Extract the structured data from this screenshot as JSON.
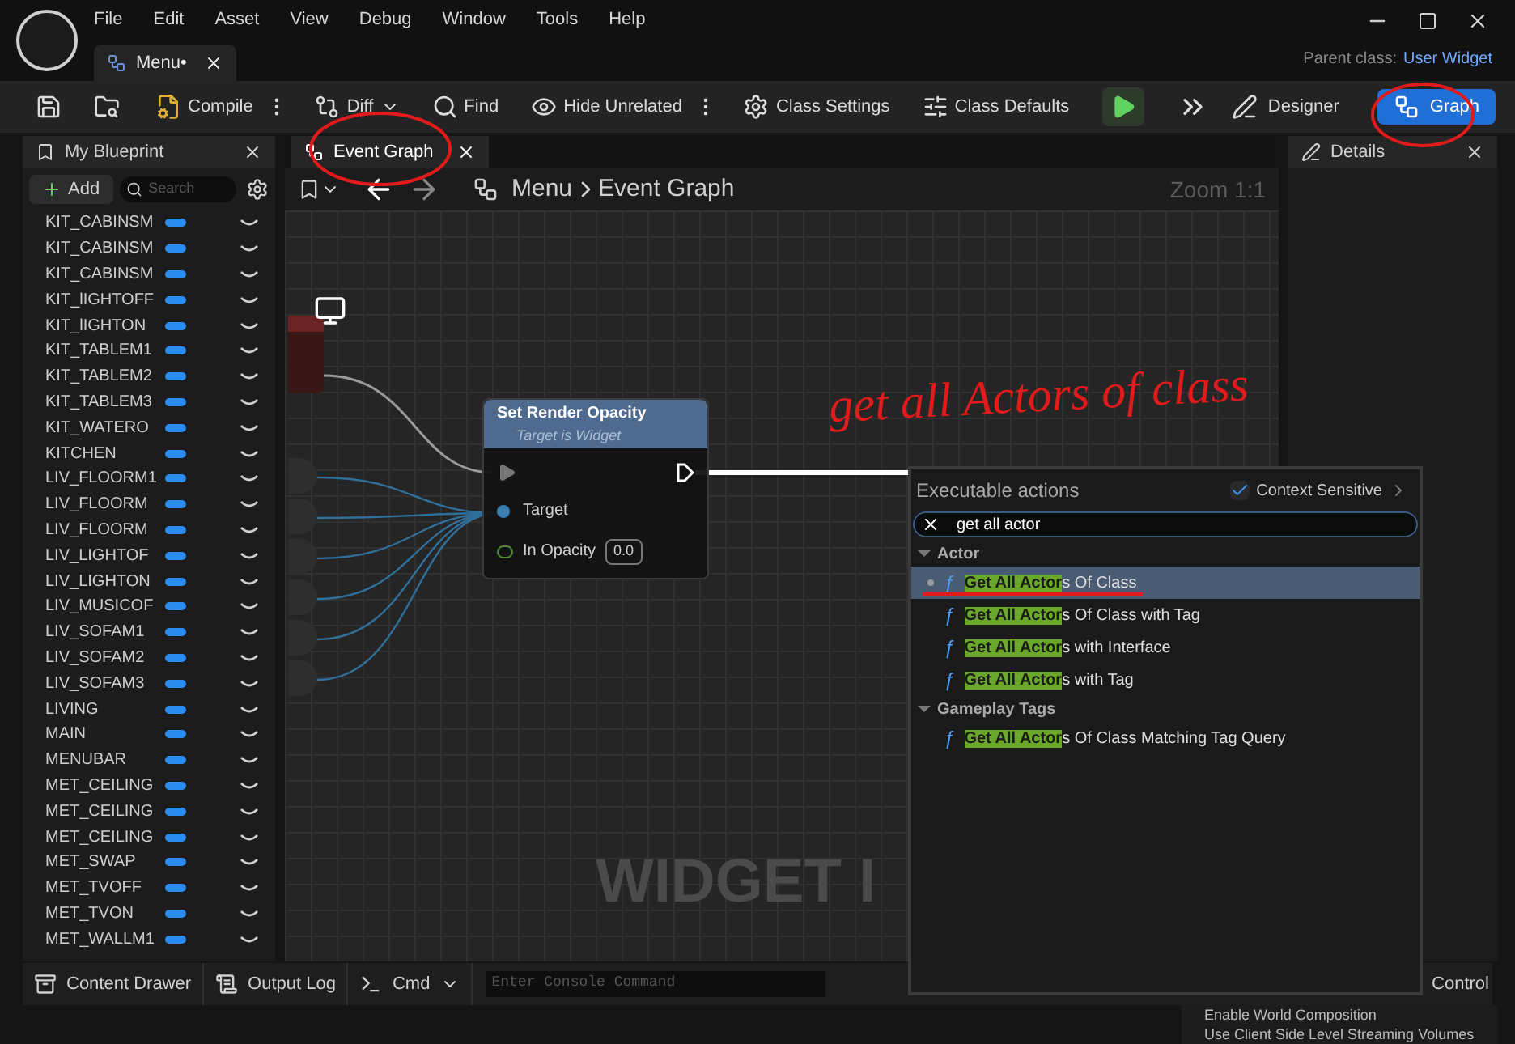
{
  "menu_bar": [
    "File",
    "Edit",
    "Asset",
    "View",
    "Debug",
    "Window",
    "Tools",
    "Help"
  ],
  "document_tab": {
    "label": "Menu•"
  },
  "parent_class": {
    "label": "Parent class:",
    "value": "User Widget"
  },
  "toolbar": [
    {
      "label": "Compile",
      "kind": "compile"
    },
    {
      "label": "Diff",
      "kind": "diff"
    },
    {
      "label": "Find",
      "kind": "find"
    },
    {
      "label": "Hide Unrelated",
      "kind": "hide"
    },
    {
      "label": "Class Settings",
      "kind": "settings"
    },
    {
      "label": "Class Defaults",
      "kind": "defaults"
    }
  ],
  "modes": [
    {
      "label": "Designer",
      "selected": false
    },
    {
      "label": "Graph",
      "selected": true
    }
  ],
  "my_blueprint": {
    "title": "My Blueprint",
    "add_label": "Add",
    "search_placeholder": "Search",
    "variables": [
      {
        "name": "KIT_CABINSM"
      },
      {
        "name": "KIT_CABINSM"
      },
      {
        "name": "KIT_CABINSM"
      },
      {
        "name": "KIT_lIGHTOFF"
      },
      {
        "name": "KIT_lIGHTON"
      },
      {
        "name": "KIT_TABLEM1"
      },
      {
        "name": "KIT_TABLEM2"
      },
      {
        "name": "KIT_TABLEM3"
      },
      {
        "name": "KIT_WATERO"
      },
      {
        "name": "KITCHEN"
      },
      {
        "name": "LIV_FLOORM1"
      },
      {
        "name": "LIV_FLOORM"
      },
      {
        "name": "LIV_FLOORM"
      },
      {
        "name": "LIV_LIGHTOF"
      },
      {
        "name": "LIV_LIGHTON"
      },
      {
        "name": "LIV_MUSICOF"
      },
      {
        "name": "LIV_SOFAM1"
      },
      {
        "name": "LIV_SOFAM2"
      },
      {
        "name": "LIV_SOFAM3"
      },
      {
        "name": "LIVING"
      },
      {
        "name": "MAIN"
      },
      {
        "name": "MENUBAR"
      },
      {
        "name": "MET_CEILING"
      },
      {
        "name": "MET_CEILING"
      },
      {
        "name": "MET_CEILING"
      },
      {
        "name": "MET_SWAP"
      },
      {
        "name": "MET_TVOFF"
      },
      {
        "name": "MET_TVON"
      },
      {
        "name": "MET_WALLM1"
      }
    ]
  },
  "graph_tab": {
    "label": "Event Graph"
  },
  "details_tab": {
    "label": "Details"
  },
  "graph": {
    "breadcrumb": [
      "Menu",
      "Event Graph"
    ],
    "zoom": "Zoom 1:1",
    "watermark": "WIDGET I",
    "node": {
      "title": "Set Render Opacity",
      "subtitle": "Target is Widget",
      "target_label": "Target",
      "opacity_label": "In Opacity",
      "opacity_value": "0.0"
    }
  },
  "annotation": {
    "text": "get all Actors of class"
  },
  "action_menu": {
    "title": "Executable actions",
    "context_sensitive": {
      "label": "Context Sensitive",
      "checked": true
    },
    "search_value": "get all actor",
    "categories": [
      {
        "label": "Actor",
        "expanded": true,
        "items": [
          {
            "icon": "ƒ",
            "match": "Get All Actor",
            "rest": "s Of Class",
            "selected": true
          },
          {
            "icon": "ƒ",
            "match": "Get All Actor",
            "rest": "s Of Class with Tag",
            "selected": false
          },
          {
            "icon": "ƒ",
            "match": "Get All Actor",
            "rest": "s with Interface",
            "selected": false
          },
          {
            "icon": "ƒ",
            "match": "Get All Actor",
            "rest": "s with Tag",
            "selected": false
          }
        ]
      },
      {
        "label": "Gameplay Tags",
        "expanded": true,
        "items": [
          {
            "icon": "ƒ",
            "match": "Get All Actor",
            "rest": "s Of Class Matching Tag Query",
            "selected": false
          }
        ]
      }
    ]
  },
  "bottom_bar": {
    "items": [
      "Content Drawer",
      "Output Log",
      "Cmd"
    ],
    "console_placeholder": "Enter Console Command",
    "cut_label": "Control"
  },
  "background_panel": {
    "rows": [
      "Enable World Composition",
      "Use Client Side Level Streaming Volumes"
    ]
  }
}
